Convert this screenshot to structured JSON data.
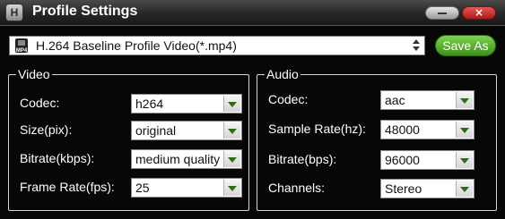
{
  "window": {
    "title": "Profile Settings",
    "app_icon_glyph": "H"
  },
  "format": {
    "selected": "H.264 Baseline Profile Video(*.mp4)",
    "icon_label": "MP4"
  },
  "buttons": {
    "save_as": "Save As",
    "close_glyph": "×"
  },
  "video": {
    "legend": "Video",
    "fields": [
      {
        "label": "Codec:",
        "value": "h264"
      },
      {
        "label": "Size(pix):",
        "value": "original"
      },
      {
        "label": "Bitrate(kbps):",
        "value": "medium quality"
      },
      {
        "label": "Frame Rate(fps):",
        "value": "25"
      }
    ]
  },
  "audio": {
    "legend": "Audio",
    "fields": [
      {
        "label": "Codec:",
        "value": "aac"
      },
      {
        "label": "Sample Rate(hz):",
        "value": "48000"
      },
      {
        "label": "Bitrate(bps):",
        "value": "96000"
      },
      {
        "label": "Channels:",
        "value": "Stereo"
      }
    ]
  },
  "colors": {
    "accent_green": "#4caf2a",
    "close_red": "#c62828",
    "dropdown_arrow": "#2f6a14"
  }
}
